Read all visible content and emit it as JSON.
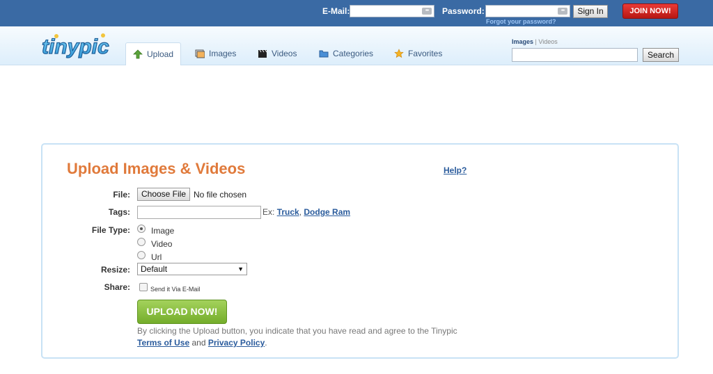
{
  "topbar": {
    "email_label": "E-Mail:",
    "password_label": "Password:",
    "signin_label": "Sign In",
    "join_label": "JOIN NOW!",
    "forgot_label": "Forgot your password?"
  },
  "brand": {
    "logo_text": "tinypic",
    "accent": "#e07a3b",
    "link": "#2a5b9c"
  },
  "nav": {
    "tabs": [
      {
        "label": "Upload",
        "icon": "up-arrow-icon",
        "active": true
      },
      {
        "label": "Images",
        "icon": "images-icon"
      },
      {
        "label": "Videos",
        "icon": "clapperboard-icon"
      },
      {
        "label": "Categories",
        "icon": "folder-icon"
      },
      {
        "label": "Favorites",
        "icon": "star-icon"
      }
    ],
    "search_scope": {
      "images": "Images",
      "separator": "|",
      "videos": "Videos"
    },
    "search_button": "Search"
  },
  "upload": {
    "title": "Upload Images & Videos",
    "help": "Help?",
    "file_label": "File:",
    "choose_file": "Choose File",
    "no_file": "No file chosen",
    "tags_label": "Tags:",
    "tags_value": "",
    "tags_example_prefix": "Ex:",
    "tags_example_1": "Truck",
    "tags_example_sep": ",",
    "tags_example_2": "Dodge Ram",
    "filetype_label": "File Type:",
    "filetype_options": [
      "Image",
      "Video",
      "Url"
    ],
    "filetype_selected": "Image",
    "resize_label": "Resize:",
    "resize_value": "Default",
    "share_label": "Share:",
    "share_option": "Send it Via E-Mail",
    "upload_button": "UPLOAD NOW!",
    "agree_text": "By clicking the Upload button, you indicate that you have read and agree to the Tinypic",
    "terms": "Terms of Use",
    "and": "and",
    "privacy": "Privacy Policy",
    "period": "."
  }
}
